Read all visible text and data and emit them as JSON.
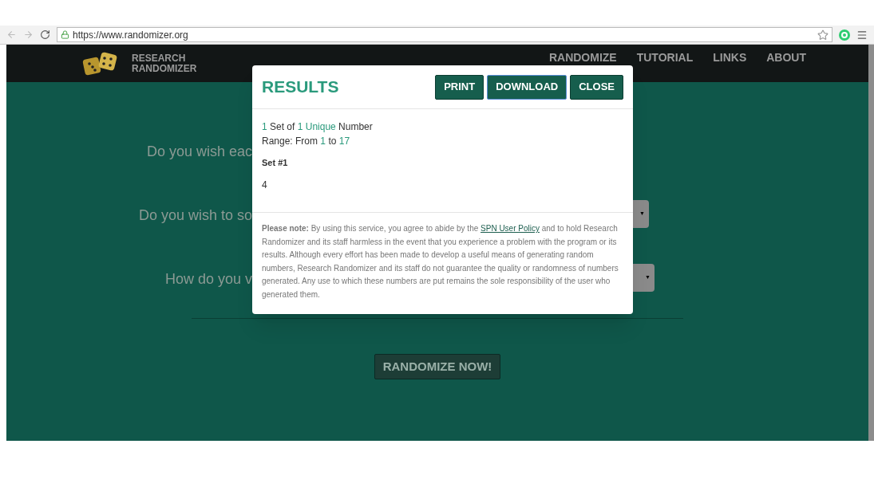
{
  "browser": {
    "url": "https://www.randomizer.org"
  },
  "site": {
    "logo_lines": [
      "RESEARCH",
      "RANDOMIZER"
    ],
    "nav": [
      "RANDOMIZE",
      "TUTORIAL",
      "LINKS",
      "ABOUT"
    ]
  },
  "questions": [
    {
      "text": "Do you wish eac"
    },
    {
      "text": "Do you wish to so",
      "select_caret": "▼"
    },
    {
      "text": "How do you v",
      "select_caret": "▼"
    }
  ],
  "randomize_button": "RANDOMIZE NOW!",
  "modal": {
    "title": "RESULTS",
    "buttons": [
      {
        "label": "PRINT",
        "focused": false
      },
      {
        "label": "DOWNLOAD",
        "focused": true
      },
      {
        "label": "CLOSE",
        "focused": false
      }
    ],
    "summary": [
      [
        {
          "text": "1",
          "highlight": true
        },
        {
          "text": " Set of ",
          "highlight": false
        },
        {
          "text": "1 Unique",
          "highlight": true
        },
        {
          "text": " Number",
          "highlight": false
        }
      ],
      [
        {
          "text": "Range: From ",
          "highlight": false
        },
        {
          "text": "1",
          "highlight": true
        },
        {
          "text": " to ",
          "highlight": false
        },
        {
          "text": "17",
          "highlight": true
        }
      ]
    ],
    "set_label": "Set #1",
    "set_values": "4",
    "note": {
      "label": "Please note:",
      "before": " By using this service, you agree to abide by the ",
      "link": "SPN User Policy",
      "after": " and to hold Research Randomizer and its staff harmless in the event that you experience a problem with the program or its results. Although every effort has been made to develop a useful means of generating random numbers, Research Randomizer and its staff do not guarantee the quality or randomness of numbers generated. Any use to which these numbers are put remains the sole responsibility of the user who generated them."
    }
  }
}
